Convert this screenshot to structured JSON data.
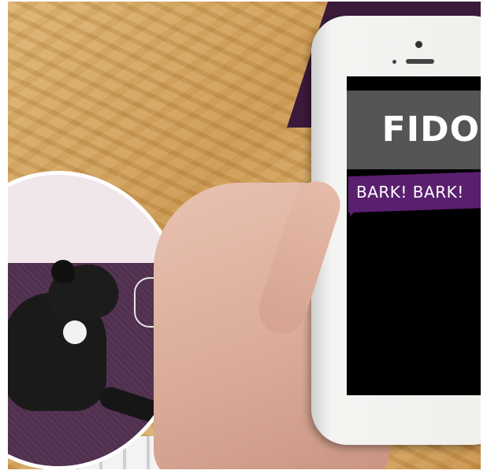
{
  "app": {
    "title": "FIDO"
  },
  "message": {
    "text": "BARK! BARK!"
  },
  "colors": {
    "header_bg": "#555555",
    "bubble_bg": "#5a1f6f",
    "screen_bg": "#000000",
    "text": "#ffffff"
  }
}
